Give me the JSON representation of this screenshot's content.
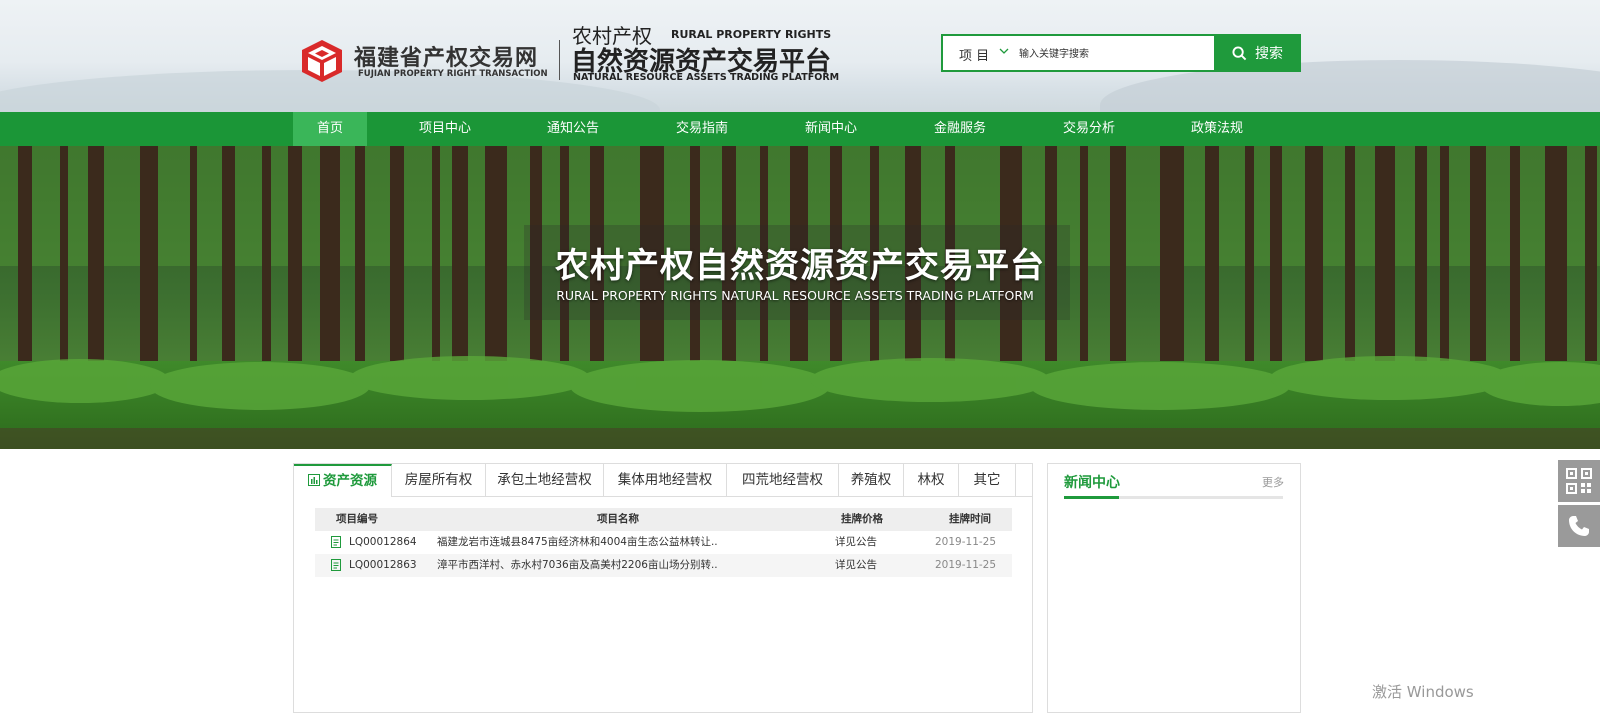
{
  "header": {
    "brand_cn": "福建省产权交易网",
    "brand_en": "FUJIAN PROPERTY RIGHT TRANSACTION",
    "platform_cn_small": "农村产权",
    "platform_en_small": "RURAL PROPERTY RIGHTS",
    "platform_cn_large": "自然资源资产交易平台",
    "platform_en_large": "NATURAL RESOURCE ASSETS TRADING PLATFORM",
    "logo_icon": "cube-logo-icon"
  },
  "search": {
    "category": "项 目",
    "placeholder": "输入关键字搜索",
    "button_label": "搜索"
  },
  "nav": {
    "items": [
      {
        "label": "首页",
        "active": true
      },
      {
        "label": "项目中心"
      },
      {
        "label": "通知公告"
      },
      {
        "label": "交易指南"
      },
      {
        "label": "新闻中心"
      },
      {
        "label": "金融服务"
      },
      {
        "label": "交易分析"
      },
      {
        "label": "政策法规"
      }
    ]
  },
  "banner": {
    "title": "农村产权自然资源资产交易平台",
    "subtitle": "RURAL PROPERTY RIGHTS NATURAL RESOURCE ASSETS TRADING PLATFORM"
  },
  "assets": {
    "tabs": [
      "资产资源",
      "房屋所有权",
      "承包土地经营权",
      "集体用地经营权",
      "四荒地经营权",
      "养殖权",
      "林权",
      "其它"
    ],
    "columns": [
      "项目编号",
      "项目名称",
      "挂牌价格",
      "挂牌时间"
    ],
    "rows": [
      {
        "id": "LQ00012864",
        "name": "福建龙岩市连城县8475亩经济林和4004亩生态公益林转让..",
        "price": "详见公告",
        "date": "2019-11-25"
      },
      {
        "id": "LQ00012863",
        "name": "漳平市西洋村、赤水村7036亩及高美村2206亩山场分别转..",
        "price": "详见公告",
        "date": "2019-11-25"
      }
    ]
  },
  "news": {
    "title": "新闻中心",
    "more": "更多"
  },
  "side": {
    "qr_icon": "qr-code-icon",
    "phone_icon": "phone-icon"
  },
  "watermark": "激活 Windows",
  "colors": {
    "primary_green": "#1f9a3c",
    "nav_green": "#1b9637",
    "nav_active": "#3ab659",
    "logo_red": "#d92a2a"
  }
}
